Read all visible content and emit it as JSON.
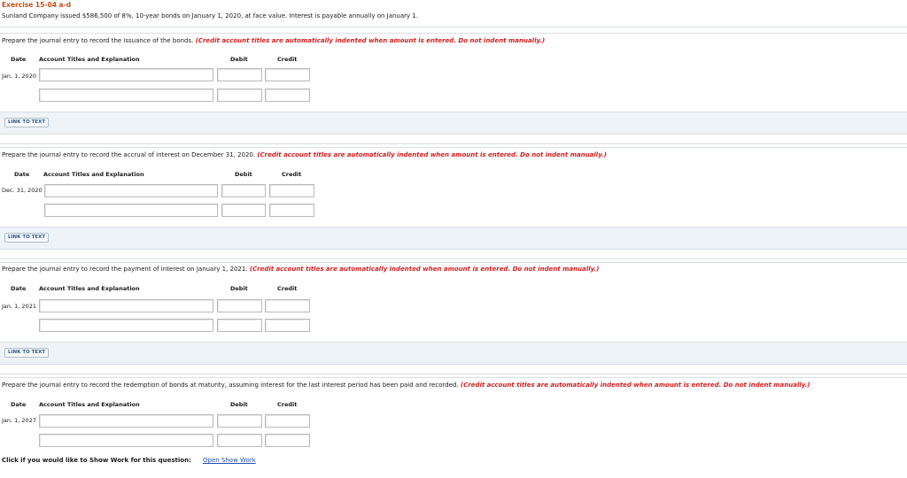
{
  "exercise_title": "Exercise 15-04 a-d",
  "intro": "Sunland Company issued $586,500 of 8%, 10-year bonds on January 1, 2020, at face value. Interest is payable annually on January 1.",
  "instruction": "(Credit account titles are automatically indented when amount is entered. Do not indent manually.)",
  "table_headers": {
    "date": "Date",
    "account": "Account Titles and Explanation",
    "debit": "Debit",
    "credit": "Credit"
  },
  "link_to_text": "LINK TO TEXT",
  "parts": [
    {
      "prompt": "Prepare the journal entry to record the issuance of the bonds.",
      "date": "Jan. 1, 2020"
    },
    {
      "prompt": "Prepare the journal entry to record the accrual of interest on December 31, 2020.",
      "date": "Dec. 31, 2020"
    },
    {
      "prompt": "Prepare the journal entry to record the payment of interest on January 1, 2021.",
      "date": "Jan. 1, 2021"
    },
    {
      "prompt": "Prepare the journal entry to record the redemption of bonds at maturity, assuming interest for the last interest period has been paid and recorded.",
      "date": "Jan. 1, 2027"
    }
  ],
  "show_work": {
    "label": "Click if you would like to Show Work for this question:",
    "link": "Open Show Work"
  }
}
